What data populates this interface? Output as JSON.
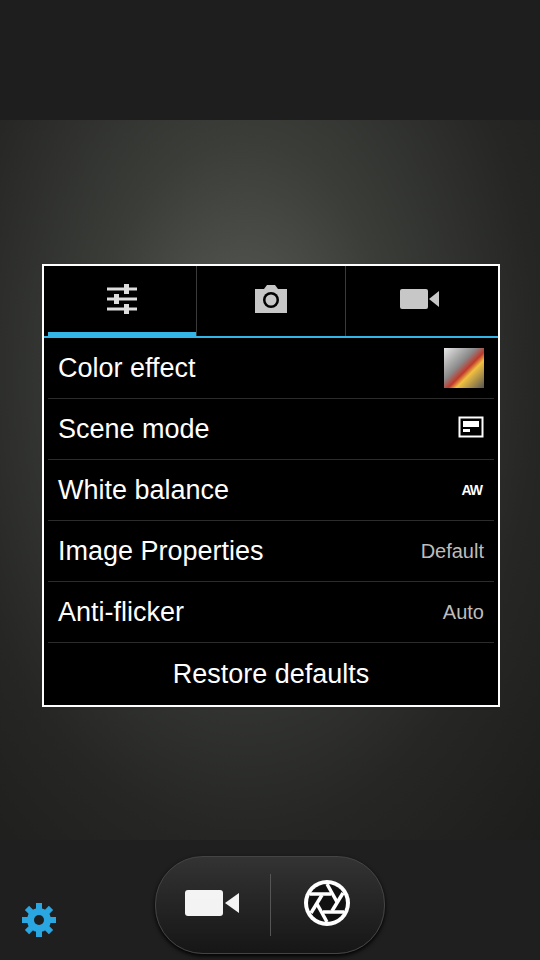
{
  "settings_panel": {
    "tabs": [
      {
        "kind": "general",
        "selected": true
      },
      {
        "kind": "photo",
        "selected": false
      },
      {
        "kind": "video",
        "selected": false
      }
    ],
    "rows": [
      {
        "label": "Color effect",
        "kind": "thumbnail"
      },
      {
        "label": "Scene mode",
        "kind": "icon"
      },
      {
        "label": "White balance",
        "kind": "badge",
        "value": "AW"
      },
      {
        "label": "Image Properties",
        "kind": "text",
        "value": "Default"
      },
      {
        "label": "Anti-flicker",
        "kind": "text",
        "value": "Auto"
      }
    ],
    "restore_button": "Restore defaults"
  },
  "mode_switch": {
    "video_selected": false,
    "photo_selected": true
  }
}
